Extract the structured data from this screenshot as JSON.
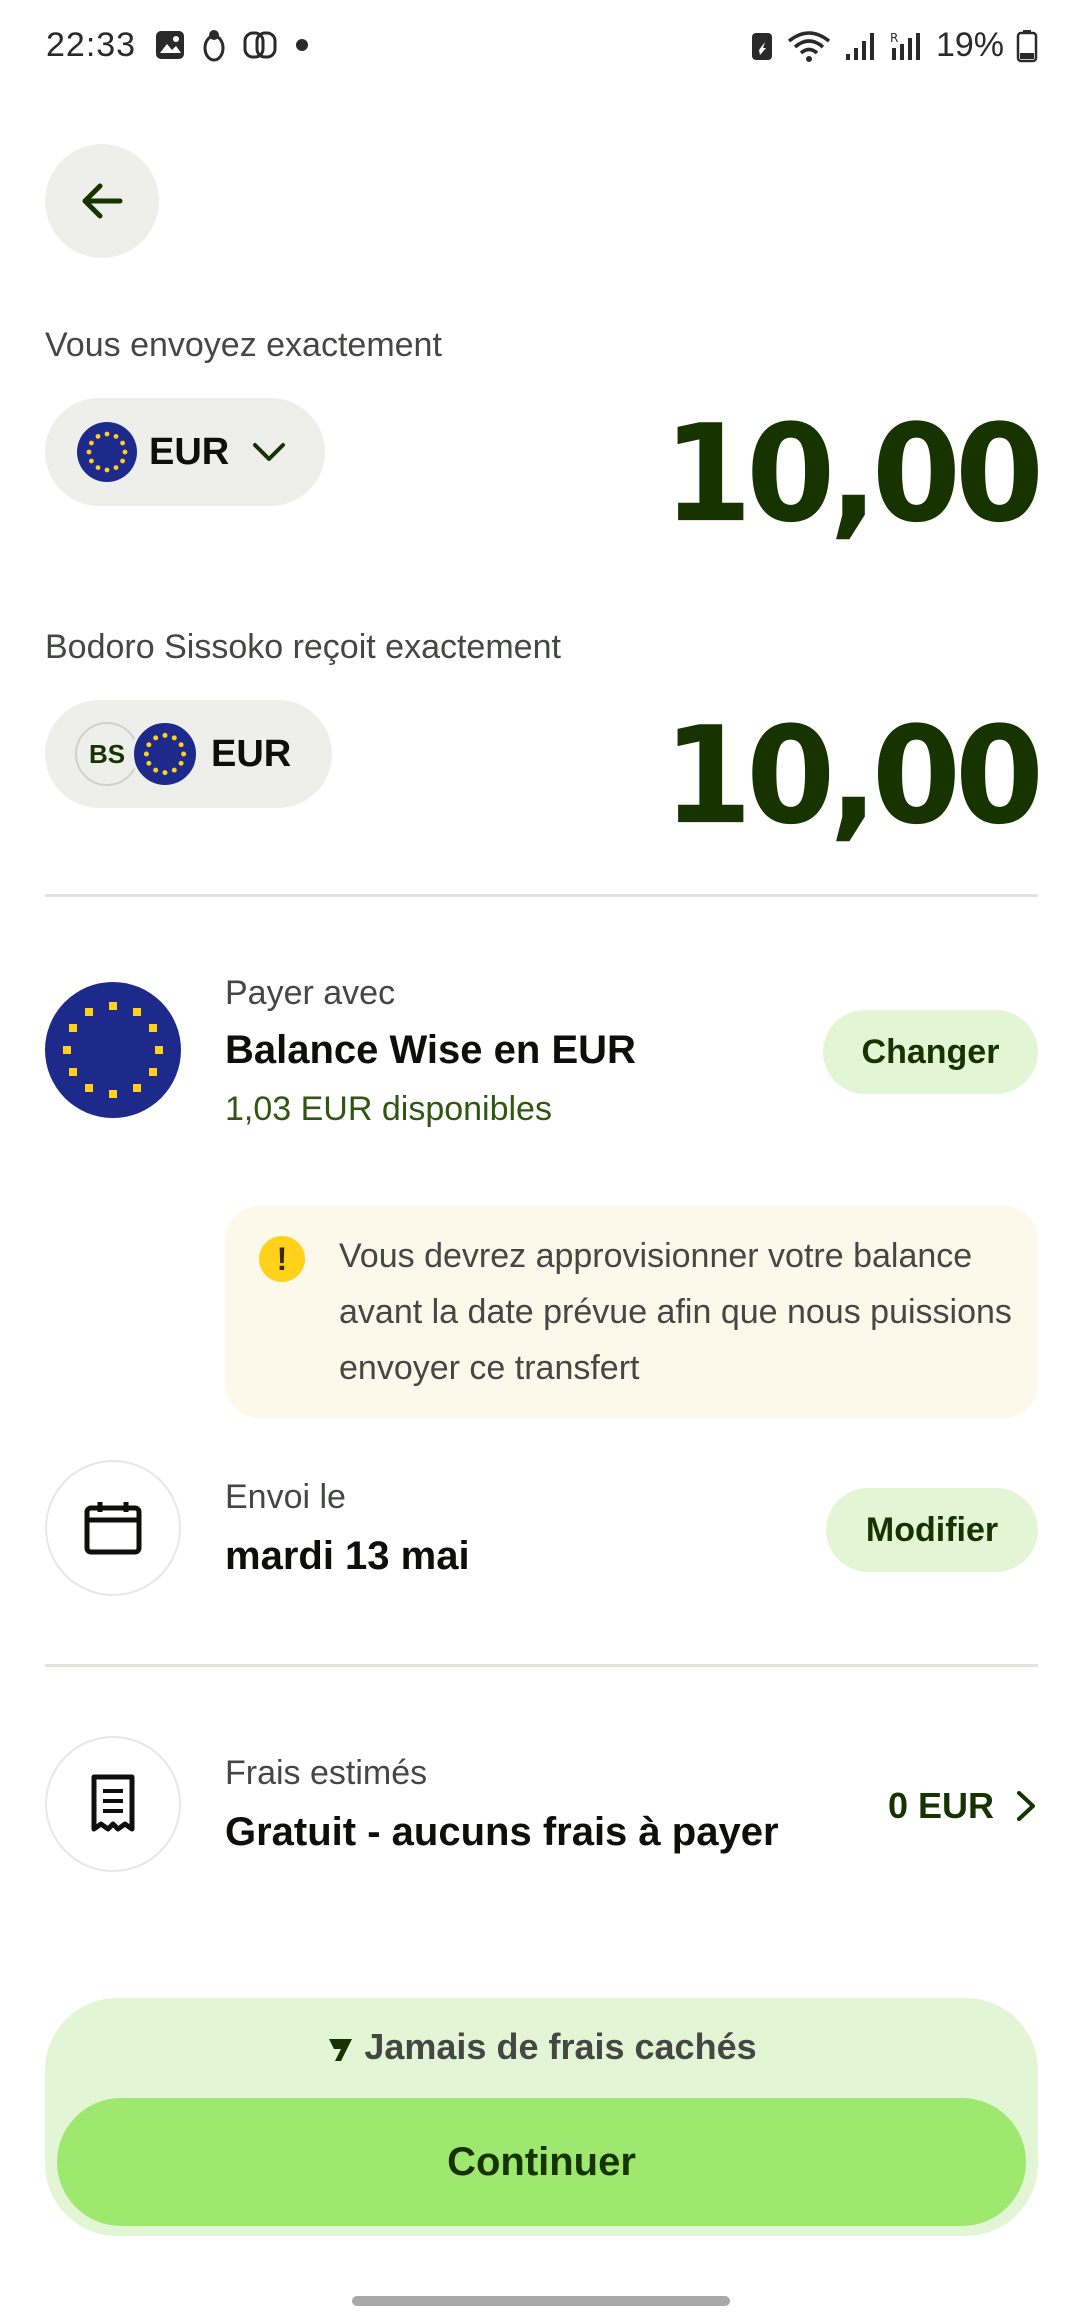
{
  "status_bar": {
    "time": "22:33",
    "battery_percent": "19%",
    "icons_left": [
      "gallery-icon",
      "notification-app-icon",
      "link-icon",
      "dot-icon"
    ],
    "icons_right": [
      "battery-saver-icon",
      "wifi-icon",
      "signal-icon",
      "signal-roaming-icon",
      "battery-icon"
    ]
  },
  "send": {
    "label": "Vous envoyez exactement",
    "currency": "EUR",
    "amount": "10,00"
  },
  "receive": {
    "label": "Bodoro Sissoko reçoit exactement",
    "recipient_initials": "BS",
    "currency": "EUR",
    "amount": "10,00"
  },
  "pay_with": {
    "label": "Payer avec",
    "method": "Balance Wise en EUR",
    "available": "1,03 EUR disponibles",
    "change_label": "Changer"
  },
  "warning": {
    "text": "Vous devrez approvisionner votre balance avant la date prévue afin que nous puissions envoyer ce transfert",
    "icon_glyph": "!"
  },
  "send_date": {
    "label": "Envoi le",
    "date": "mardi 13 mai",
    "modify_label": "Modifier"
  },
  "fees": {
    "label": "Frais estimés",
    "value": "Gratuit - aucuns frais à payer",
    "amount": "0 EUR"
  },
  "footer": {
    "no_hidden_fees": "Jamais de frais cachés",
    "continue_label": "Continuer"
  },
  "colors": {
    "brand_green": "#9fe870",
    "dark_green": "#163300",
    "light_green": "#e2f6d5",
    "warning_bg": "#fcf8ea",
    "eu_blue": "#1d2a8c",
    "eu_star": "#ffd11a"
  }
}
